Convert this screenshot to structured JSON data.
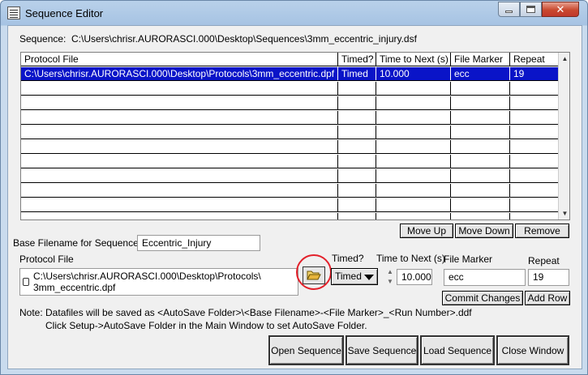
{
  "window": {
    "title": "Sequence Editor",
    "close_glyph": "✕"
  },
  "sequence": {
    "label": "Sequence:",
    "path": "C:\\Users\\chrisr.AURORASCI.000\\Desktop\\Sequences\\3mm_eccentric_injury.dsf"
  },
  "table": {
    "headers": [
      "Protocol File",
      "Timed?",
      "Time to Next (s)",
      "File Marker",
      "Repeat"
    ],
    "rows": [
      {
        "protocol_file": "C:\\Users\\chrisr.AURORASCI.000\\Desktop\\Protocols\\3mm_eccentric.dpf",
        "timed": "Timed",
        "time_to_next": "10.000",
        "file_marker": "ecc",
        "repeat": "19",
        "selected": true
      }
    ],
    "empty_rows": 10
  },
  "row_buttons": {
    "move_up": "Move Up",
    "move_down": "Move Down",
    "remove": "Remove"
  },
  "base_filename": {
    "label": "Base Filename for Sequence",
    "value": "Eccentric_Injury"
  },
  "editor": {
    "protocol_file_label": "Protocol File",
    "protocol_file_line1": "C:\\Users\\chrisr.AURORASCI.000\\Desktop\\Protocols\\",
    "protocol_file_line2": "3mm_eccentric.dpf",
    "timed_label": "Timed?",
    "timed_value": "Timed",
    "time_to_next_label": "Time to Next (s)",
    "time_to_next_value": "10.000",
    "file_marker_label": "File Marker",
    "file_marker_value": "ecc",
    "repeat_label": "Repeat",
    "repeat_value": "19",
    "commit_changes": "Commit Changes",
    "add_row": "Add Row"
  },
  "notes": {
    "line1": "Note: Datafiles will be saved as <AutoSave Folder>\\<Base Filename>-<File Marker>_<Run Number>.ddf",
    "line2": "Click Setup->AutoSave Folder in the Main Window to set AutoSave Folder."
  },
  "bottom_buttons": {
    "open_sequence": "Open Sequence",
    "save_sequence": "Save Sequence",
    "load_sequence": "Load Sequence",
    "close_window": "Close Window"
  },
  "colors": {
    "selection": "#0a14c8",
    "highlight_circle": "#e3202a"
  },
  "icons": {
    "folder": "folder-open-icon",
    "scroll_up": "▲",
    "scroll_down": "▼",
    "stepper_up": "▲",
    "stepper_down": "▼"
  }
}
